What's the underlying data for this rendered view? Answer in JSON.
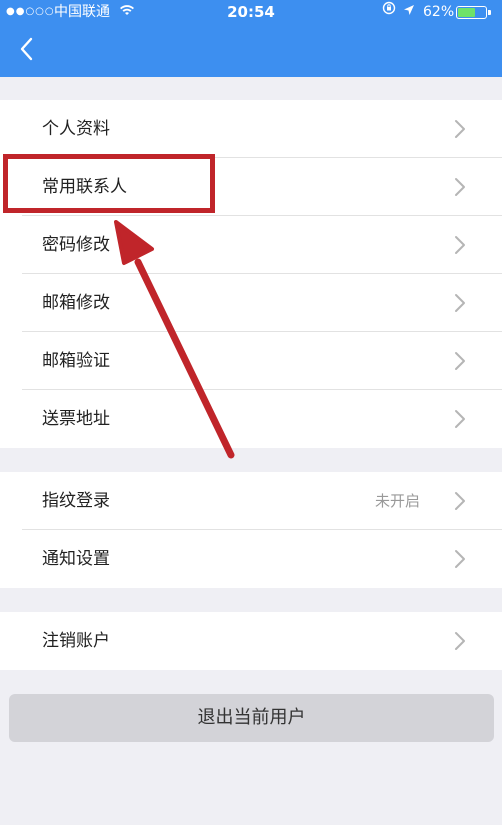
{
  "status_bar": {
    "signal": "●●○○○",
    "carrier": "中国联通",
    "time": "20:54",
    "battery_percent": "62%",
    "battery_level": 0.62,
    "wifi_icon": "wifi-icon",
    "location_icon": "location-arrow-icon",
    "rotation_lock_icon": "rotation-lock-icon"
  },
  "nav": {
    "back_icon": "chevron-left-icon"
  },
  "sections": [
    {
      "items": [
        {
          "label": "个人资料"
        },
        {
          "label": "常用联系人"
        },
        {
          "label": "密码修改"
        },
        {
          "label": "邮箱修改"
        },
        {
          "label": "邮箱验证"
        },
        {
          "label": "送票地址"
        }
      ]
    },
    {
      "items": [
        {
          "label": "指纹登录",
          "value": "未开启"
        },
        {
          "label": "通知设置"
        }
      ]
    },
    {
      "items": [
        {
          "label": "注销账户"
        }
      ]
    }
  ],
  "logout_label": "退出当前用户",
  "colors": {
    "header": "#3d8ff0",
    "background": "#efeff4",
    "annotation": "#c0252a",
    "battery_fill": "#6ee26a"
  }
}
